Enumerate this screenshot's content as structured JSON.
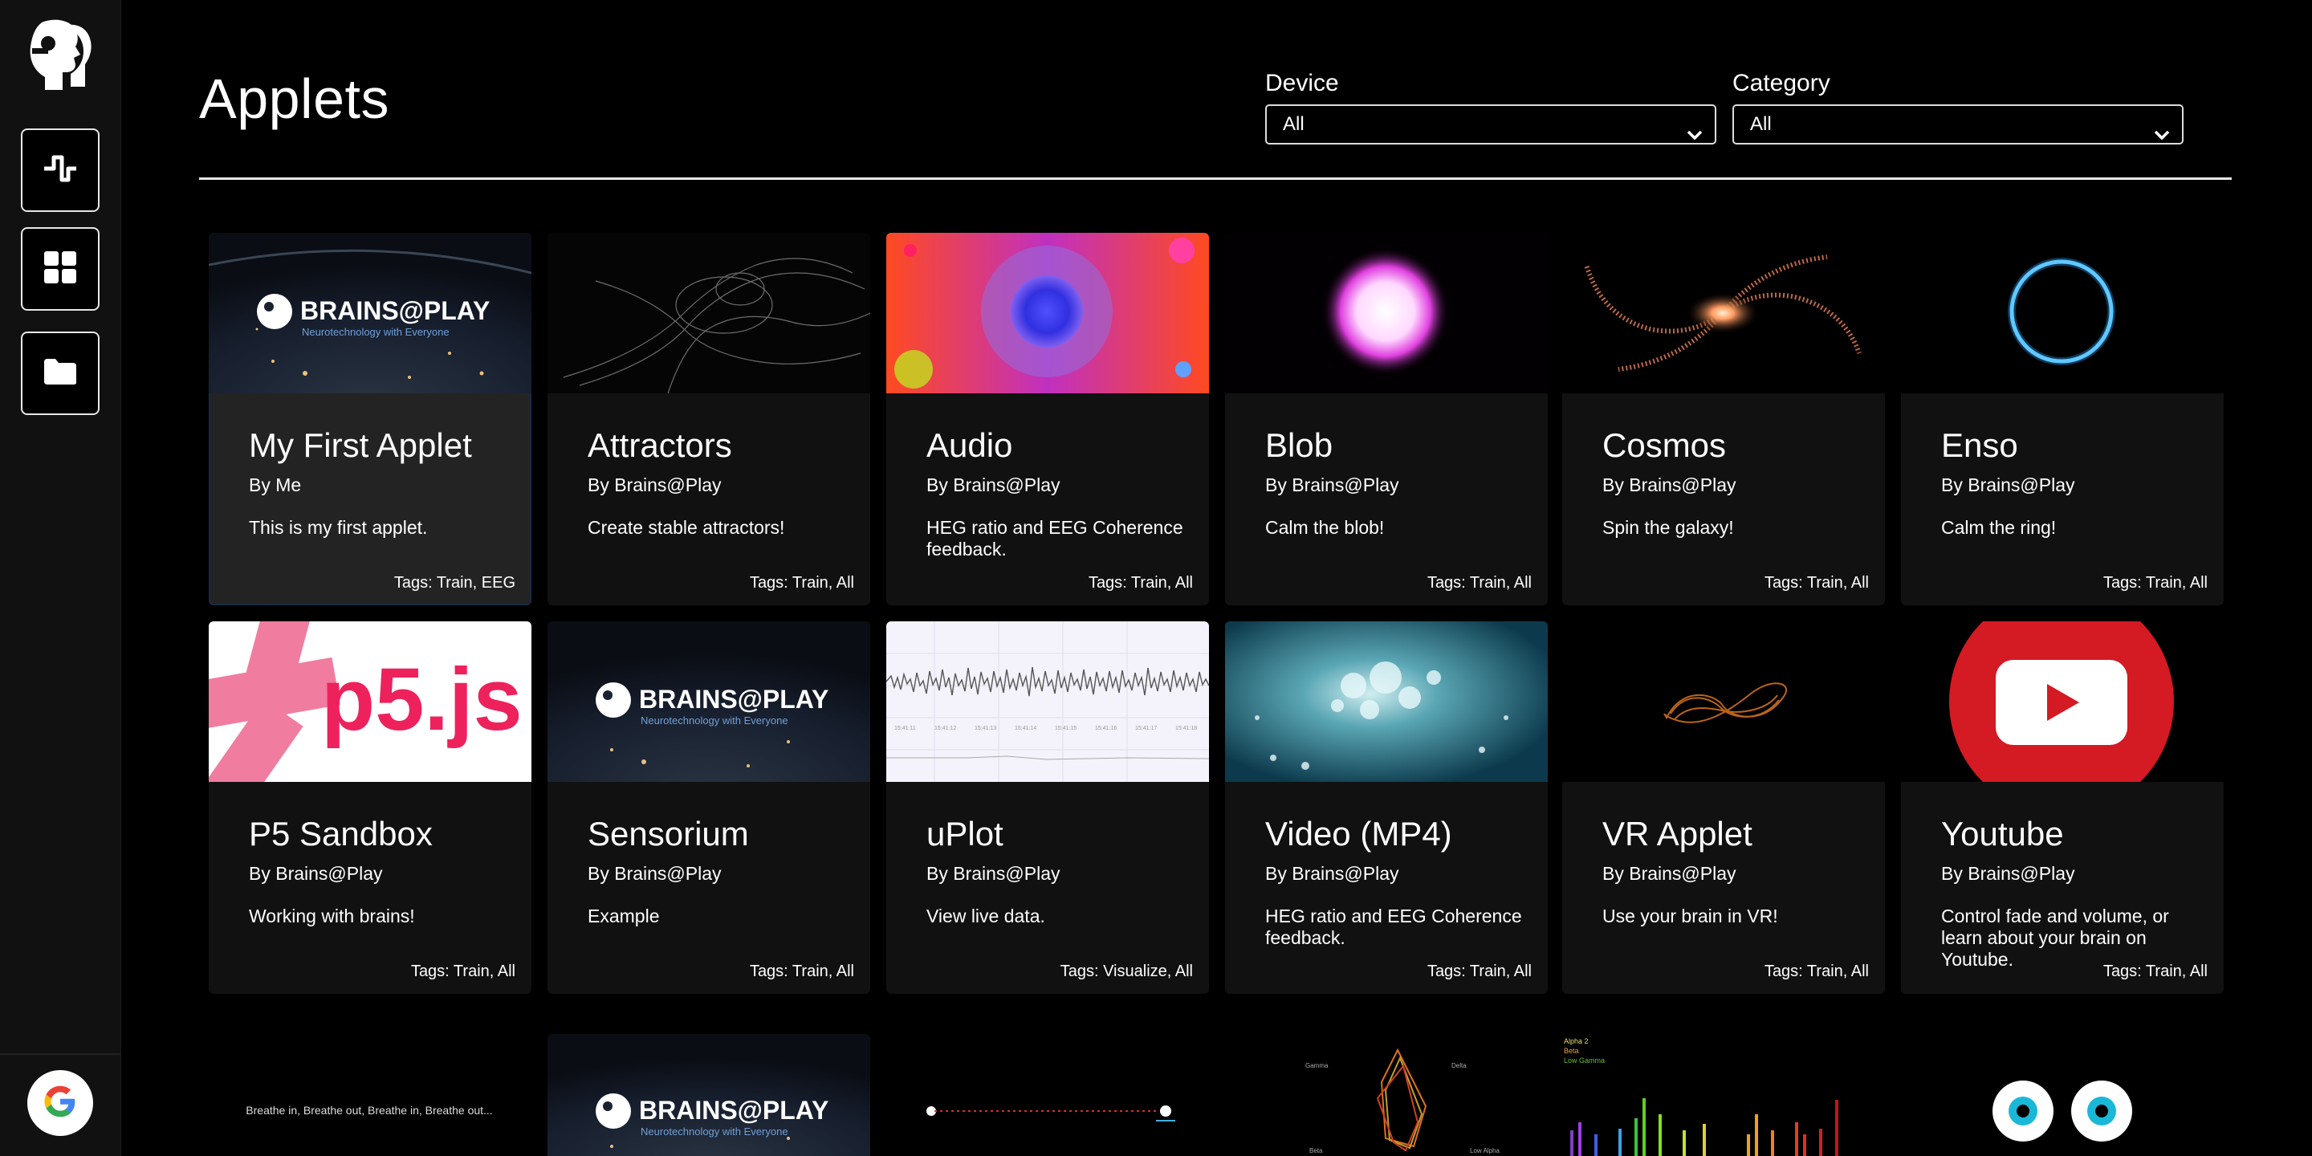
{
  "page": {
    "title": "Applets"
  },
  "filters": {
    "device": {
      "label": "Device",
      "value": "All"
    },
    "category": {
      "label": "Category",
      "value": "All"
    }
  },
  "sidebar": {
    "buttons": [
      {
        "icon": "signal-icon"
      },
      {
        "icon": "grid-icon"
      },
      {
        "icon": "folder-icon"
      }
    ],
    "footer_icon": "google-icon"
  },
  "brand": {
    "name": "BRAINS@PLAY",
    "tagline": "Neurotechnology with Everyone",
    "p5_logo": "p5.js"
  },
  "applets": [
    {
      "title": "My First Applet",
      "author": "By Me",
      "description": "This is my first applet.",
      "tags": "Tags: Train, EEG",
      "thumbnail": "brains-at-play-logo"
    },
    {
      "title": "Attractors",
      "author": "By Brains@Play",
      "description": "Create stable attractors!",
      "tags": "Tags: Train, All",
      "thumbnail": "attractor-particles"
    },
    {
      "title": "Audio",
      "author": "By Brains@Play",
      "description": "HEG ratio and EEG Coherence feedback.",
      "tags": "Tags: Train, All",
      "thumbnail": "audio-flower"
    },
    {
      "title": "Blob",
      "author": "By Brains@Play",
      "description": "Calm the blob!",
      "tags": "Tags: Train, All",
      "thumbnail": "glowing-blob"
    },
    {
      "title": "Cosmos",
      "author": "By Brains@Play",
      "description": "Spin the galaxy!",
      "tags": "Tags: Train, All",
      "thumbnail": "spiral-galaxy"
    },
    {
      "title": "Enso",
      "author": "By Brains@Play",
      "description": "Calm the ring!",
      "tags": "Tags: Train, All",
      "thumbnail": "blue-ring"
    },
    {
      "title": "P5 Sandbox",
      "author": "By Brains@Play",
      "description": "Working with brains!",
      "tags": "Tags: Train, All",
      "thumbnail": "p5js-logo"
    },
    {
      "title": "Sensorium",
      "author": "By Brains@Play",
      "description": "Example",
      "tags": "Tags: Train, All",
      "thumbnail": "brains-at-play-logo"
    },
    {
      "title": "uPlot",
      "author": "By Brains@Play",
      "description": "View live data.",
      "tags": "Tags: Visualize, All",
      "thumbnail": "eeg-trace"
    },
    {
      "title": "Video (MP4)",
      "author": "By Brains@Play",
      "description": "HEG ratio and EEG Coherence feedback.",
      "tags": "Tags: Train, All",
      "thumbnail": "ocean-water"
    },
    {
      "title": "VR Applet",
      "author": "By Brains@Play",
      "description": "Use your brain in VR!",
      "tags": "Tags: Train, All",
      "thumbnail": "orange-loop"
    },
    {
      "title": "Youtube",
      "author": "By Brains@Play",
      "description": "Control fade and volume, or learn about your brain on Youtube.",
      "tags": "Tags: Train, All",
      "thumbnail": "youtube-logo"
    }
  ],
  "partial_row": [
    {
      "thumbnail": "breathing-text",
      "text": "Breathe in, Breathe out, Breathe in, Breathe out..."
    },
    {
      "thumbnail": "brains-at-play-logo"
    },
    {
      "thumbnail": "sequence-slider"
    },
    {
      "thumbnail": "radar-chart",
      "labels": [
        "Gamma",
        "Delta",
        "Beta",
        "Low Alpha"
      ]
    },
    {
      "thumbnail": "band-bars",
      "labels": [
        "Alpha 2",
        "Beta",
        "Low Gamma"
      ]
    },
    {
      "thumbnail": "cartoon-eyes"
    }
  ]
}
